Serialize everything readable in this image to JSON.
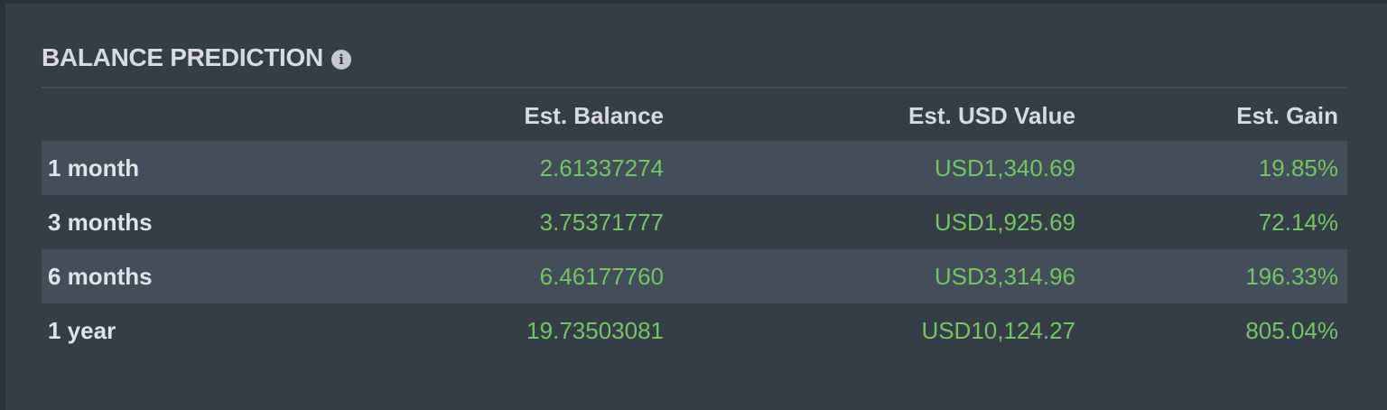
{
  "widget": {
    "title": "BALANCE PREDICTION",
    "info_icon": "info-circle-icon"
  },
  "table": {
    "columns": [
      "",
      "Est. Balance",
      "Est. USD Value",
      "Est. Gain"
    ],
    "rows": [
      {
        "period": "1 month",
        "balance": "2.61337274",
        "usd_value": "USD1,340.69",
        "gain": "19.85%"
      },
      {
        "period": "3 months",
        "balance": "3.75371777",
        "usd_value": "USD1,925.69",
        "gain": "72.14%"
      },
      {
        "period": "6 months",
        "balance": "6.46177760",
        "usd_value": "USD3,314.96",
        "gain": "196.33%"
      },
      {
        "period": "1 year",
        "balance": "19.73503081",
        "usd_value": "USD10,124.27",
        "gain": "805.04%"
      }
    ]
  },
  "colors": {
    "background": "#2b3138",
    "panel": "#353e47",
    "row_shaded": "#434e5a",
    "value_green": "#70c65f",
    "heading_text": "#d7dbdf"
  }
}
